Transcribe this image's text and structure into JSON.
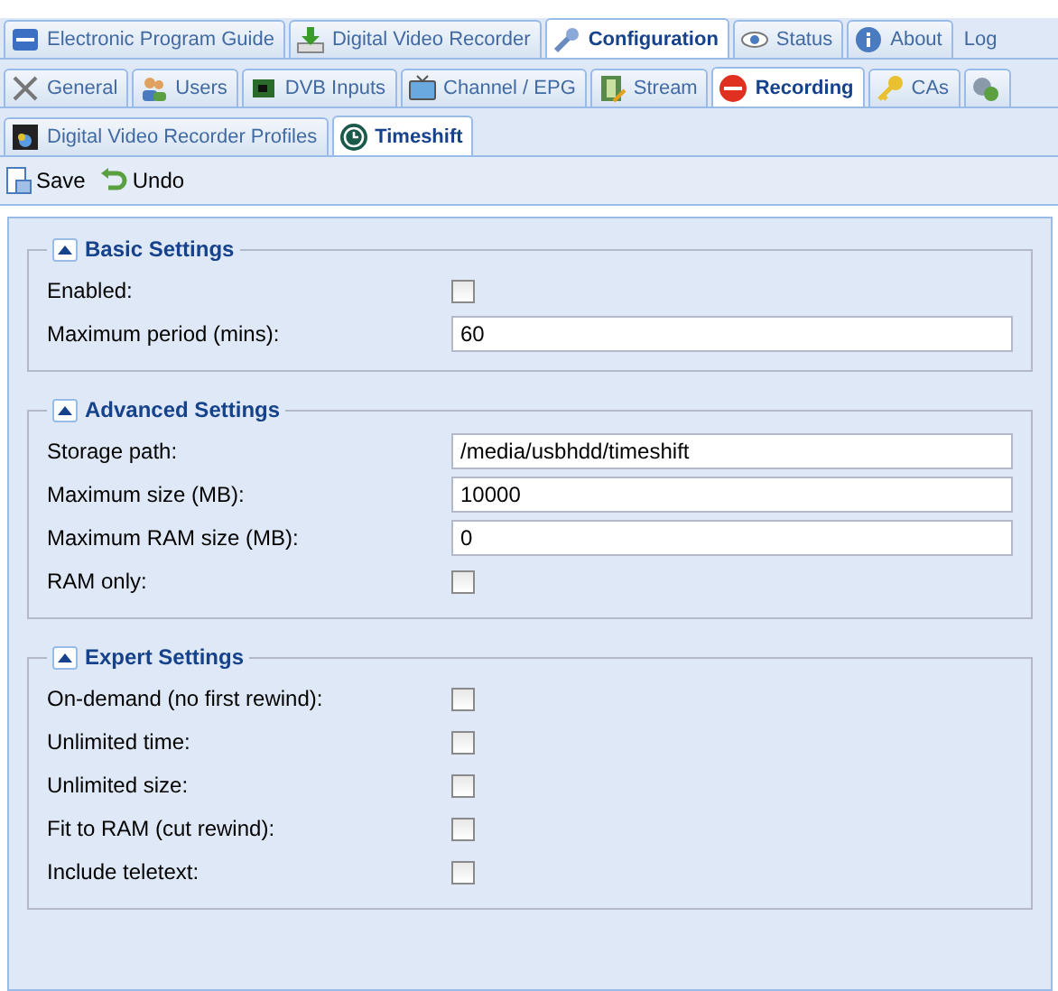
{
  "main_tabs": [
    {
      "label": "Electronic Program Guide",
      "selected": false
    },
    {
      "label": "Digital Video Recorder",
      "selected": false
    },
    {
      "label": "Configuration",
      "selected": true
    },
    {
      "label": "Status",
      "selected": false
    },
    {
      "label": "About",
      "selected": false
    },
    {
      "label": "Log",
      "kind": "link"
    }
  ],
  "config_tabs": [
    {
      "label": "General",
      "selected": false
    },
    {
      "label": "Users",
      "selected": false
    },
    {
      "label": "DVB Inputs",
      "selected": false
    },
    {
      "label": "Channel / EPG",
      "selected": false
    },
    {
      "label": "Stream",
      "selected": false
    },
    {
      "label": "Recording",
      "selected": true
    },
    {
      "label": "CAs",
      "selected": false
    },
    {
      "selected": false
    }
  ],
  "recording_tabs": [
    {
      "label": "Digital Video Recorder Profiles",
      "selected": false
    },
    {
      "label": "Timeshift",
      "selected": true
    }
  ],
  "toolbar": [
    {
      "label": "Save"
    },
    {
      "label": "Undo"
    }
  ],
  "sections": [
    {
      "title": "Basic Settings",
      "expanded": true,
      "fields": [
        {
          "kind": "checkbox",
          "label": "Enabled:",
          "checked": false
        },
        {
          "kind": "text",
          "label": "Maximum period (mins):",
          "value": "60"
        }
      ]
    },
    {
      "title": "Advanced Settings",
      "expanded": true,
      "fields": [
        {
          "kind": "text",
          "label": "Storage path:",
          "value": "/media/usbhdd/timeshift"
        },
        {
          "kind": "text",
          "label": "Maximum size (MB):",
          "value": "10000"
        },
        {
          "kind": "text",
          "label": "Maximum RAM size (MB):",
          "value": "0"
        },
        {
          "kind": "checkbox",
          "label": "RAM only:",
          "checked": false
        }
      ]
    },
    {
      "title": "Expert Settings",
      "expanded": true,
      "fields": [
        {
          "kind": "checkbox",
          "label": "On-demand (no first rewind):",
          "checked": false
        },
        {
          "kind": "checkbox",
          "label": "Unlimited time:",
          "checked": false
        },
        {
          "kind": "checkbox",
          "label": "Unlimited size:",
          "checked": false
        },
        {
          "kind": "checkbox",
          "label": "Fit to RAM (cut rewind):",
          "checked": false
        },
        {
          "kind": "checkbox",
          "label": "Include teletext:",
          "checked": false
        }
      ]
    }
  ]
}
